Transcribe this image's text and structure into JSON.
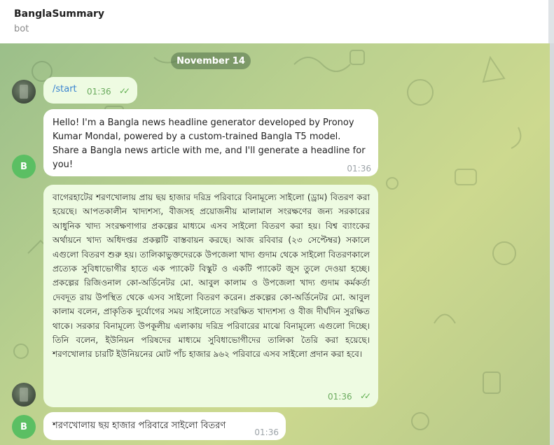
{
  "header": {
    "chat_name": "BanglaSummary",
    "status": "bot"
  },
  "date_separator": "November 14",
  "messages": [
    {
      "sender": "user",
      "text": "/start",
      "time": "01:36",
      "read": true
    },
    {
      "sender": "bot",
      "avatar_letter": "B",
      "text": "Hello! I'm a Bangla news headline generator developed by Pronoy Kumar Mondal, powered by a custom-trained Bangla T5 model. Share a Bangla news article with me, and I'll generate a headline for you!",
      "time": "01:36"
    },
    {
      "sender": "user",
      "text": "বাগেরহাটের শরণখোলায় প্রায় ছয় হাজার দরিদ্র পরিবারে বিনামূল্যে সাইলো (ড্রাম) বিতরণ করা হয়েছে। আপতকালীন খাদ্যশস্য, বীজসহ প্রয়োজনীয় মালামাল সংরক্ষণের জন্য সরকারের আধুনিক খাদ্য সংরক্ষণাগার প্রকল্পের মাধ্যমে এসব সাইলো বিতরণ করা হয়। বিশ্ব ব্যাংকের অর্থায়নে খাদ্য অধিদপ্তর প্রকল্পটি বাস্তবায়ন করছে। আজ রবিবার (২৩ সেপ্টেম্বর) সকালে এগুলো বিতরণ শুরু হয়। তালিকাভুক্তদেরকে উপজেলা খাদ্য গুদাম থেকে সাইলো বিতরণকালে প্রত্যেক সুবিধাভোগীর হাতে এক প্যাকেট বিস্কুট ও একটি প্যাকেট জুস তুলে দেওয়া হচ্ছে। প্রকল্পের রিজিওনাল কো-অর্ডিনেটর মো. আবুল কালাম ও উপজেলা খাদ্য গুদাম কর্মকর্তা দেবদূত রায় উপস্থিত থেকে এসব সাইলো বিতরণ করেন। প্রকল্পের কো-অর্ডিনেটর মো. আবুল কালাম বলেন, প্রাকৃতিক দুর্যোগের সময় সাইলোতে সংরক্ষিত খাদ্যশস্য ও বীজ দীর্ঘদিন সুরক্ষিত থাকে। সরকার বিনামূল্যে উপকূলীয় এলাকায় দরিদ্র পরিবারের মাঝে বিনামূল্যে এগুলো দিচ্ছে। তিনি বলেন, ইউনিয়ন পরিষদের মাধ্যমে সুবিধাভোগীদের তালিকা তৈরি করা হয়েছে। শরণখোলার চারটি ইউনিয়নের মোট পাঁচ হাজার ৯৬২ পরিবারে এসব সাইলো প্রদান করা হবে।",
      "time": "01:36",
      "read": true
    },
    {
      "sender": "bot",
      "avatar_letter": "B",
      "text": "শরণখোলায় ছয় হাজার পরিবারে সাইলো বিতরণ",
      "time": "01:36"
    }
  ]
}
